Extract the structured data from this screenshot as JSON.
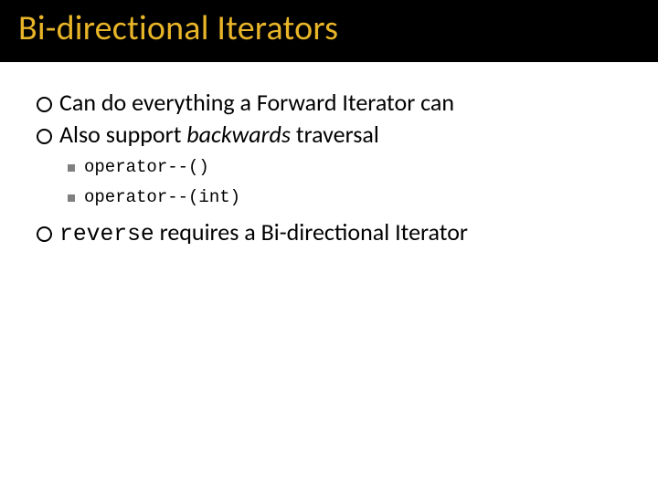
{
  "title": "Bi-directional Iterators",
  "bullets": {
    "b1": "Can do everything a Forward Iterator can",
    "b2_pre": "Also support ",
    "b2_italic": "backwards",
    "b2_post": " traversal",
    "s1": "operator--()",
    "s2": "operator--(int)",
    "b3_code": "reverse",
    "b3_post": " requires a Bi-directional Iterator"
  }
}
